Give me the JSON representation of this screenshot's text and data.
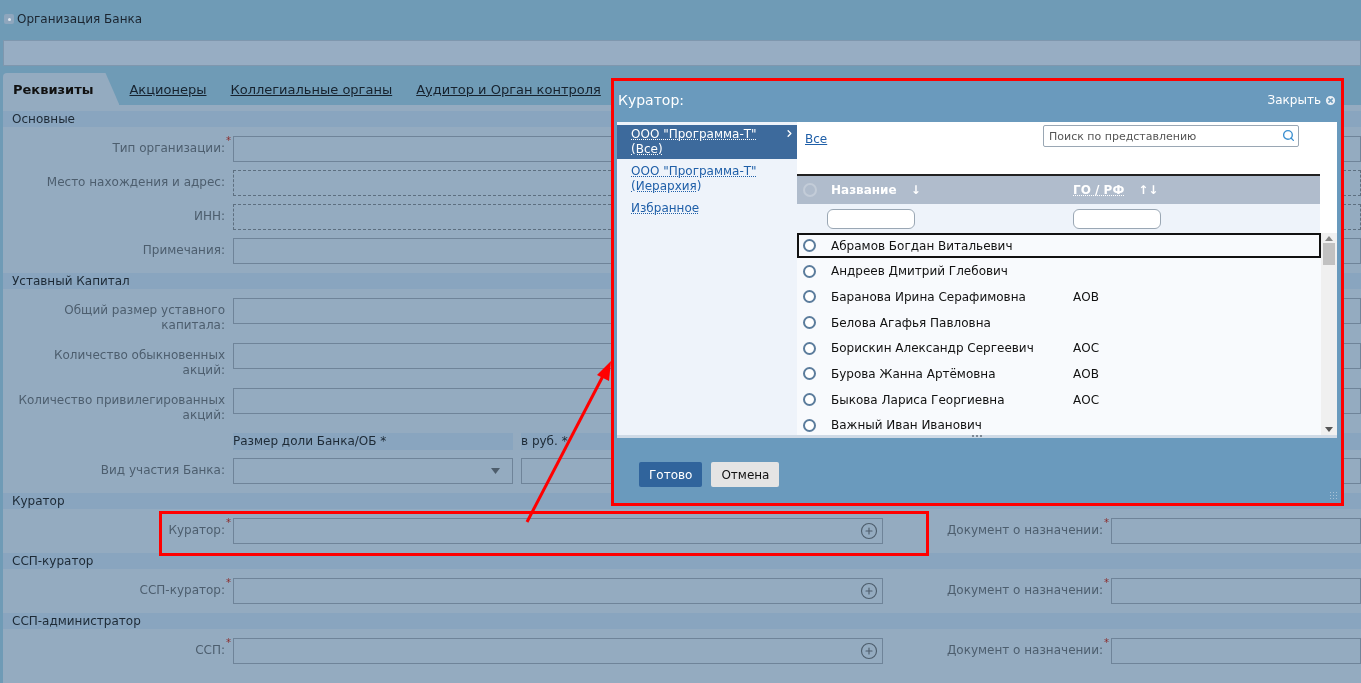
{
  "window": {
    "title": "Организация Банка"
  },
  "tabs": [
    {
      "label": "Реквизиты",
      "selected": true
    },
    {
      "label": "Акционеры",
      "selected": false
    },
    {
      "label": "Коллегиальные органы",
      "selected": false
    },
    {
      "label": "Аудитор и Орган контроля",
      "selected": false
    }
  ],
  "sections": [
    {
      "title": "Основные",
      "fields": [
        {
          "kind": "text",
          "label": "Тип организации:",
          "mark": "*"
        },
        {
          "kind": "dashed",
          "label": "Место нахождения и адрес:"
        },
        {
          "kind": "dashed",
          "label": "ИНН:"
        },
        {
          "kind": "text",
          "label": "Примечания:"
        }
      ]
    },
    {
      "title": "Уставный Капитал",
      "fields": [
        {
          "kind": "text",
          "label": "Общий размер уставного капитала:"
        },
        {
          "kind": "text",
          "label": "Количество обыкновенных акций:"
        },
        {
          "kind": "text",
          "label": "Количество привилегированных акций:"
        },
        {
          "kind": "columns",
          "columns": [
            "Размер доли Банка/ОБ *",
            "в руб. *"
          ]
        },
        {
          "kind": "select",
          "label": "Вид участия Банка:"
        }
      ]
    },
    {
      "title": "Куратор",
      "fields": [
        {
          "kind": "picker",
          "label": "Куратор:",
          "mark": "*",
          "doc_label": "Документ о назначении:",
          "doc_mark": "*",
          "highlighted": true
        }
      ]
    },
    {
      "title": "ССП-куратор",
      "fields": [
        {
          "kind": "picker",
          "label": "ССП-куратор:",
          "mark": "*",
          "doc_label": "Документ о назначении:",
          "doc_mark": "*",
          "highlighted": false
        }
      ]
    },
    {
      "title": "ССП-администратор",
      "fields": [
        {
          "kind": "picker",
          "label": "ССП:",
          "mark": "*",
          "doc_label": "Документ о назначении:",
          "doc_mark": "*",
          "highlighted": false
        }
      ]
    }
  ],
  "dialog": {
    "title": "Куратор:",
    "close": "Закрыть",
    "highlighted": true,
    "groups": [
      {
        "label": "ООО \"Программа-Т\" (Все)",
        "selected": true
      },
      {
        "label": "ООО \"Программа-Т\" (Иерархия)",
        "selected": false
      },
      {
        "label": "Избранное",
        "selected": false
      }
    ],
    "filter_link": "Все",
    "search": {
      "placeholder": "Поиск по представлению"
    },
    "columns": [
      {
        "label": "Название",
        "sort": "↓"
      },
      {
        "label": "ГО / РФ",
        "sort": "↑↓"
      }
    ],
    "rows": [
      {
        "name": "Абрамов Богдан Витальевич",
        "focused": true,
        "selected": false
      },
      {
        "name": "Андреев Дмитрий Глебович",
        "focused": false,
        "selected": false
      },
      {
        "name": "Баранова Ирина Серафимовна",
        "unit": "АОВ",
        "focused": false,
        "selected": false
      },
      {
        "name": "Белова Агафья Павловна",
        "focused": false,
        "selected": false
      },
      {
        "name": "Борискин Александр Сергеевич",
        "unit": "АОС",
        "focused": false,
        "selected": false
      },
      {
        "name": "Бурова Жанна Артёмовна",
        "unit": "АОВ",
        "focused": false,
        "selected": false
      },
      {
        "name": "Быкова Лариса Георгиевна",
        "unit": "АОС",
        "focused": false,
        "selected": false
      },
      {
        "name": "Важный Иван Иванович",
        "focused": false,
        "selected": false
      }
    ],
    "buttons": [
      {
        "label": "Готово",
        "kind": "primary"
      },
      {
        "label": "Отмена",
        "kind": "secondary"
      }
    ]
  }
}
